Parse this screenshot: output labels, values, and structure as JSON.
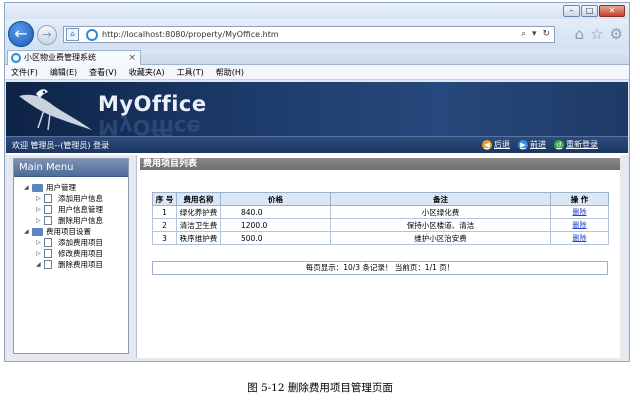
{
  "browser": {
    "url": "http://localhost:8080/property/MyOffice.htm",
    "tab_title": "小区物业费管理系统",
    "tab_close": "×",
    "menu": [
      "文件(F)",
      "编辑(E)",
      "查看(V)",
      "收藏夹(A)",
      "工具(T)",
      "帮助(H)"
    ]
  },
  "header": {
    "logo": "MyOffice",
    "welcome": "欢迎 管理员--(管理员) 登录",
    "nav_back": "后退",
    "nav_forward": "前进",
    "nav_relogin": "重新登录"
  },
  "sidebar": {
    "title": "Main Menu",
    "groups": [
      {
        "label": "用户管理",
        "items": [
          "添加用户信息",
          "用户信息管理",
          "删除用户信息"
        ]
      },
      {
        "label": "费用项目设置",
        "items": [
          "添加费用项目",
          "修改费用项目",
          "删除费用项目"
        ]
      }
    ]
  },
  "main": {
    "section_title": "费用项目列表",
    "columns": [
      "序 号",
      "费用名称",
      "价格",
      "备注",
      "操 作"
    ],
    "rows": [
      {
        "no": "1",
        "name": "绿化养护费",
        "price": "840.0",
        "note": "小区绿化费",
        "action": "删除"
      },
      {
        "no": "2",
        "name": "清洁卫生费",
        "price": "1200.0",
        "note": "保持小区楼道、清洁",
        "action": "删除"
      },
      {
        "no": "3",
        "name": "秩序维护费",
        "price": "500.0",
        "note": "维护小区治安费",
        "action": "删除"
      }
    ],
    "pager": "每页显示：10/3 条记录！ 当前页：1/1 页！"
  },
  "caption": "图 5-12  删除费用项目管理页面",
  "colors": {
    "banner": "#1f3e70",
    "table_header": "#dbe7f5",
    "link": "#2240c8"
  }
}
